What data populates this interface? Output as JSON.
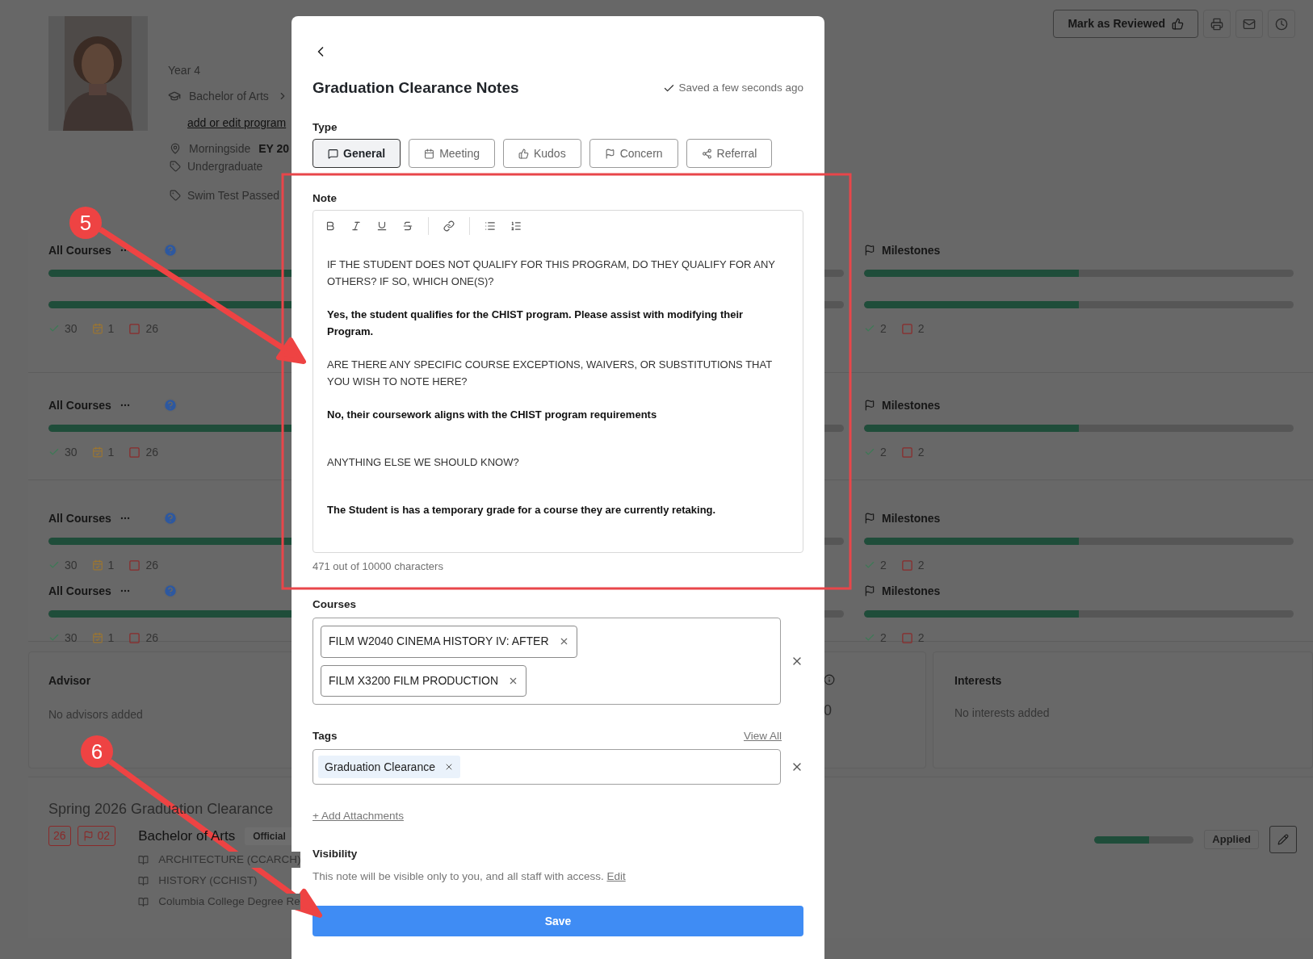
{
  "header_actions": {
    "review_button": "Mark as Reviewed"
  },
  "profile": {
    "year": "Year 4",
    "program": "Bachelor of Arts",
    "program_link": "add or edit program",
    "campus": "Morningside",
    "entry_year": "EY 20",
    "level": "Undergraduate",
    "tags": [
      "Swim Test Passed"
    ]
  },
  "progress_rows": [
    {
      "courses": [
        {
          "title": "All Courses",
          "bars": [
            {
              "level": 0.9
            },
            {
              "level": 0.9
            }
          ],
          "completed": "30",
          "scheduled": "1",
          "remaining": "26"
        }
      ],
      "milestones": [
        {
          "title": "Milestones",
          "bars": [
            {
              "level": 0.5
            },
            {
              "level": 0.5
            }
          ],
          "completed": "2",
          "remaining": "2"
        }
      ]
    },
    {
      "courses": [
        {
          "title": "All Courses",
          "bars": [
            {
              "level": 0.9
            }
          ],
          "completed": "30",
          "scheduled": "1",
          "remaining": "26"
        }
      ],
      "milestones": [
        {
          "title": "Milestones",
          "bars": [
            {
              "level": 0.5
            }
          ],
          "completed": "2",
          "remaining": "2"
        }
      ]
    },
    {
      "courses": [
        {
          "title": "All Courses",
          "bars": [
            {
              "level": 0.9
            }
          ],
          "completed": "30",
          "scheduled": "1",
          "remaining": "26"
        },
        {
          "title": "All Courses",
          "bars": [
            {
              "level": 0.9
            }
          ],
          "completed": "30",
          "scheduled": "1",
          "remaining": "26"
        }
      ],
      "milestones": [
        {
          "title": "Milestones",
          "bars": [
            {
              "level": 0.5
            }
          ],
          "completed": "2",
          "remaining": "2"
        },
        {
          "title": "Milestones",
          "bars": [
            {
              "level": 0.5
            }
          ],
          "completed": "2",
          "remaining": "2"
        }
      ]
    }
  ],
  "advisor": {
    "title": "Advisor",
    "empty": "No advisors added"
  },
  "middle_card": {
    "value": "0"
  },
  "interests": {
    "title": "Interests",
    "empty": "No interests added"
  },
  "plan": {
    "title": "Spring 2026 Graduation Clearance",
    "count_badge": "26",
    "flag_badge": "02",
    "degree": "Bachelor of Arts",
    "degree_status": "Official",
    "programs": [
      "ARCHITECTURE (CCARCH)",
      "HISTORY (CCHIST)",
      "Columbia College Degree Re"
    ],
    "progress": {
      "level": 0.55
    },
    "status": "Applied"
  },
  "dialog": {
    "title": "Graduation Clearance Notes",
    "save_status": "Saved a few seconds ago",
    "type_label": "Type",
    "types": [
      {
        "label": "General",
        "kind": "message",
        "selected": true
      },
      {
        "label": "Meeting",
        "kind": "calendar",
        "selected": false
      },
      {
        "label": "Kudos",
        "kind": "kudos",
        "selected": false
      },
      {
        "label": "Concern",
        "kind": "flag",
        "selected": false
      },
      {
        "label": "Referral",
        "kind": "share",
        "selected": false
      }
    ],
    "note_label": "Note",
    "paragraphs": [
      {
        "text": "IF THE STUDENT DOES NOT QUALIFY FOR THIS PROGRAM, DO THEY QUALIFY FOR ANY OTHERS? IF SO, WHICH ONE(S)?",
        "bold": false
      },
      {
        "text": "Yes, the student qualifies for the CHIST program. Please assist with modifying their Program.",
        "bold": true
      },
      {
        "text": "ARE THERE ANY SPECIFIC COURSE EXCEPTIONS, WAIVERS, OR SUBSTITUTIONS THAT YOU WISH TO NOTE HERE?",
        "bold": false
      },
      {
        "text": "No, their coursework aligns with the CHIST program requirements",
        "bold": true
      },
      {
        "text": "ANYTHING ELSE WE SHOULD KNOW?",
        "bold": false
      },
      {
        "text": "The Student is has a temporary grade for a course they are currently retaking.",
        "bold": true
      }
    ],
    "char_count": "471 out of 10000 characters",
    "courses_label": "Courses",
    "courses": [
      "FILM W2040 CINEMA HISTORY IV: AFTER",
      "FILM X3200 FILM PRODUCTION"
    ],
    "tags_label": "Tags",
    "view_all": "View All",
    "tags": [
      "Graduation Clearance"
    ],
    "add_attachments": "+ Add Attachments",
    "visibility_label": "Visibility",
    "visibility_text": "This note will be visible only to you, and all staff with access.",
    "visibility_link": "Edit",
    "save_button": "Save"
  },
  "annotations": [
    {
      "label": "5"
    },
    {
      "label": "6"
    }
  ]
}
